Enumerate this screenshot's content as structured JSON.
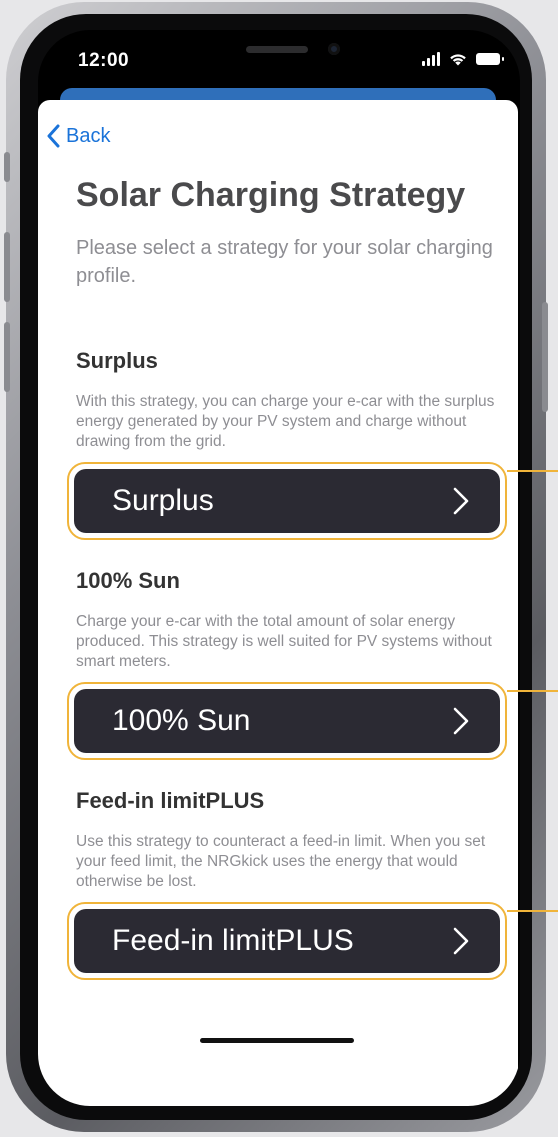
{
  "status_bar": {
    "time": "12:00"
  },
  "nav": {
    "back_label": "Back"
  },
  "page": {
    "title": "Solar Charging Strategy",
    "subtitle": "Please select a strategy for your solar charging profile."
  },
  "strategies": [
    {
      "heading": "Surplus",
      "description": "With this strategy, you can charge your e-car with the surplus energy generated by your PV system and charge without drawing from the grid.",
      "button_label": "Surplus"
    },
    {
      "heading": "100% Sun",
      "description": "Charge your e-car with the total amount of solar energy produced. This strategy is well suited for PV systems without smart meters.",
      "button_label": "100% Sun"
    },
    {
      "heading": "Feed-in limitPLUS",
      "description": "Use this strategy to counteract a feed-in limit. When you set your feed limit, the NRGkick uses the energy that would otherwise be lost.",
      "button_label": "Feed-in limitPLUS"
    }
  ],
  "colors": {
    "accent_link": "#1a73d9",
    "button_bg": "#2b2a33",
    "highlight_outline": "#f0b43a",
    "sheet_behind": "#2f6fba"
  },
  "icons": {
    "back": "chevron-left-icon",
    "option": "chevron-right-icon",
    "signal": "cellular-signal-icon",
    "wifi": "wifi-icon",
    "battery": "battery-icon"
  }
}
